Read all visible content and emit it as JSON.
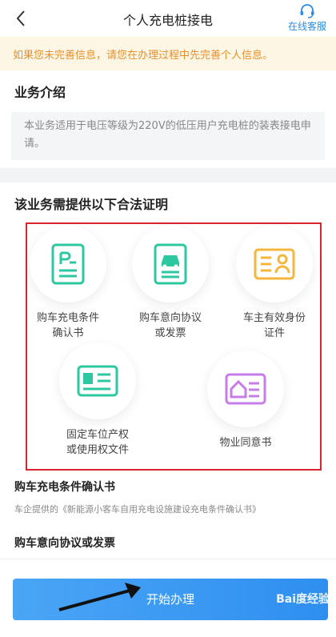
{
  "header": {
    "title": "个人充电桩接电",
    "service_label": "在线客服"
  },
  "notice": {
    "text": "如果您未完善信息，请您在办理过程中先完善个人信息。"
  },
  "intro": {
    "title": "业务介绍",
    "text": "本业务适用于电压等级为220V的低压用户充电桩的装表接电申请。"
  },
  "proofs": {
    "title": "该业务需提供以下合法证明",
    "items": [
      {
        "label": "购车充电条件\n确认书",
        "icon": "parking-doc-icon",
        "color": "#2ec8a0"
      },
      {
        "label": "购车意向协议\n或发票",
        "icon": "car-doc-icon",
        "color": "#2ec8a0"
      },
      {
        "label": "车主有效身份\n证件",
        "icon": "id-card-icon",
        "color": "#f5b63d"
      },
      {
        "label": "固定车位产权\n或使用权文件",
        "icon": "parking-card-icon",
        "color": "#2ec8a0"
      },
      {
        "label": "物业同意书",
        "icon": "house-card-icon",
        "color": "#c77de8"
      }
    ]
  },
  "details": [
    {
      "title": "购车充电条件确认书",
      "text": "车企提供的《新能源小客车自用充电设施建设充电条件确认书》"
    },
    {
      "title": "购车意向协议或发票"
    }
  ],
  "footer": {
    "start_label": "开始办理",
    "watermark": "Bai度经验"
  }
}
